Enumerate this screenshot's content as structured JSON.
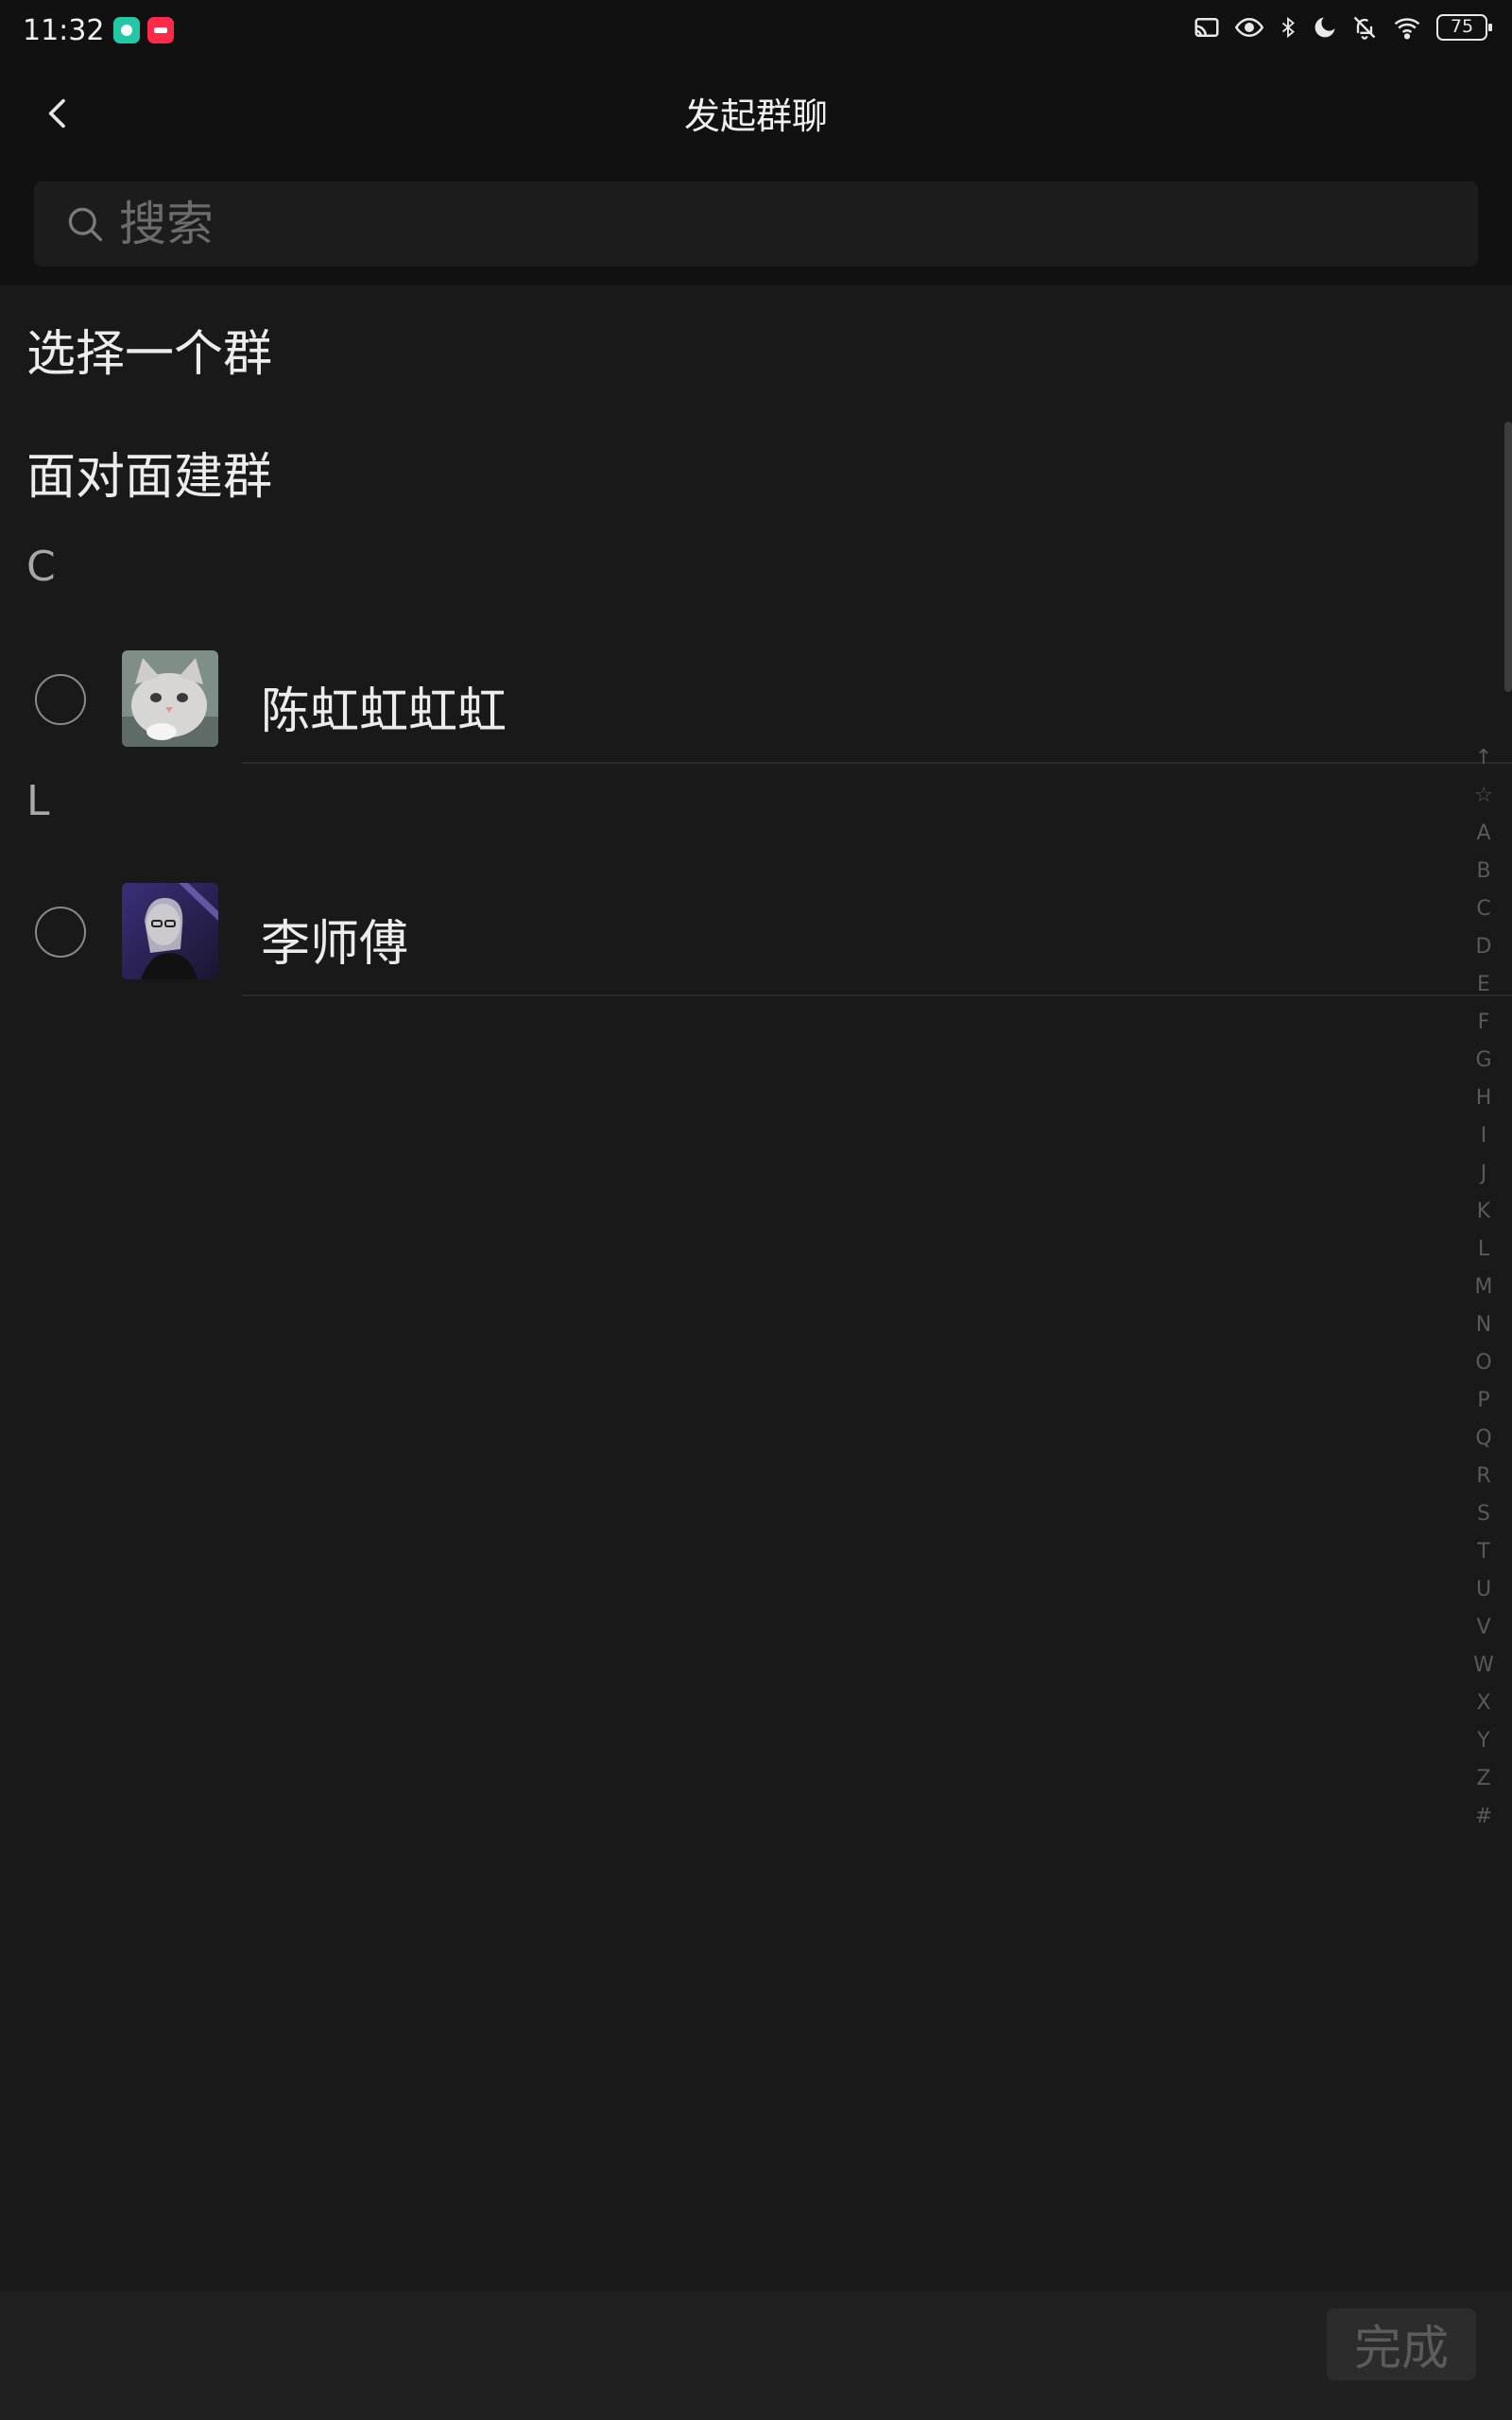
{
  "status_bar": {
    "time": "11:32",
    "battery": "75",
    "icons": [
      "cast-icon",
      "eye-icon",
      "bluetooth-icon",
      "moon-icon",
      "bell-off-icon",
      "wifi-icon"
    ],
    "app_badges": [
      {
        "name": "app-badge-green",
        "color": "#22c7a5"
      },
      {
        "name": "app-badge-red",
        "color": "#ff2a4a"
      }
    ]
  },
  "nav": {
    "title": "发起群聊",
    "back_icon": "back-arrow-icon"
  },
  "search": {
    "placeholder": "搜索",
    "value": ""
  },
  "menu": {
    "select_group": "选择一个群",
    "face_to_face": "面对面建群"
  },
  "sections": [
    {
      "letter": "C",
      "contacts": [
        {
          "name": "陈虹虹虹虹",
          "selected": false,
          "avatar": "cat-avatar"
        }
      ]
    },
    {
      "letter": "L",
      "contacts": [
        {
          "name": "李师傅",
          "selected": false,
          "avatar": "person-avatar"
        }
      ]
    }
  ],
  "index_bar": [
    "↑",
    "☆",
    "A",
    "B",
    "C",
    "D",
    "E",
    "F",
    "G",
    "H",
    "I",
    "J",
    "K",
    "L",
    "M",
    "N",
    "O",
    "P",
    "Q",
    "R",
    "S",
    "T",
    "U",
    "V",
    "W",
    "X",
    "Y",
    "Z",
    "#"
  ],
  "bottom": {
    "done_label": "完成"
  },
  "colors": {
    "background": "#191919",
    "header": "#111111",
    "bottom_bar": "#202020"
  }
}
